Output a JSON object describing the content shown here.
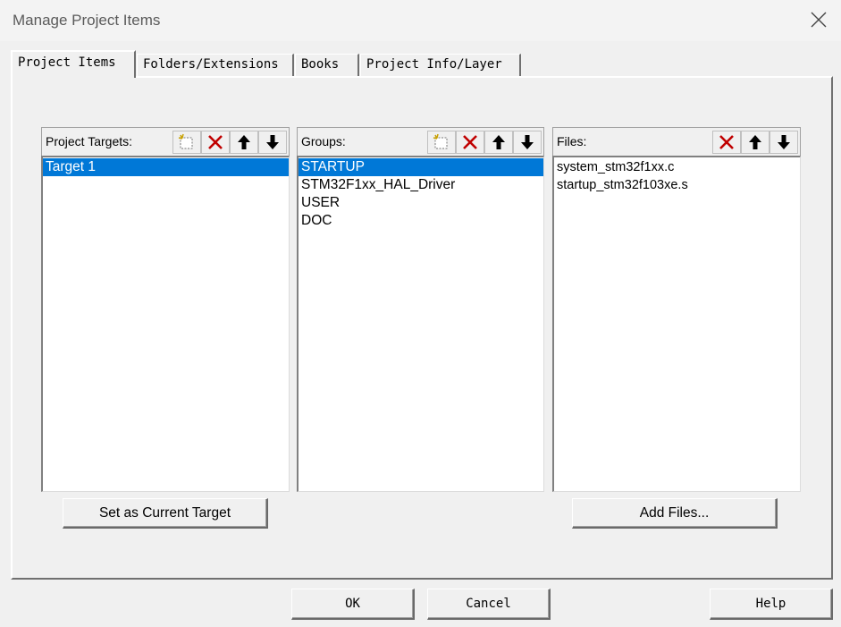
{
  "window": {
    "title": "Manage Project Items"
  },
  "tabs": [
    {
      "label": "Project Items",
      "active": true
    },
    {
      "label": "Folders/Extensions",
      "active": false
    },
    {
      "label": "Books",
      "active": false
    },
    {
      "label": "Project Info/Layer",
      "active": false
    }
  ],
  "targets_panel": {
    "label": "Project Targets:",
    "items": [
      "Target 1"
    ],
    "selected": "Target 1"
  },
  "groups_panel": {
    "label": "Groups:",
    "items": [
      "STARTUP",
      "STM32F1xx_HAL_Driver",
      "USER",
      "DOC"
    ],
    "selected": "STARTUP"
  },
  "files_panel": {
    "label": "Files:",
    "items": [
      "system_stm32f1xx.c",
      "startup_stm32f103xe.s"
    ]
  },
  "buttons": {
    "set_current_target": "Set as Current Target",
    "add_files": "Add Files...",
    "ok": "OK",
    "cancel": "Cancel",
    "help": "Help"
  },
  "colors": {
    "selection": "#0078d7",
    "delete_icon": "#c00000",
    "background": "#f0f0f0"
  }
}
